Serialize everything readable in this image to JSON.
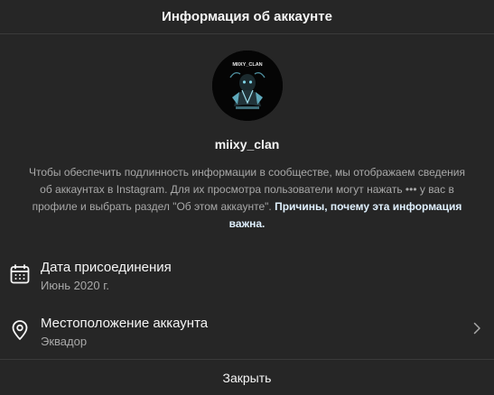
{
  "header": {
    "title": "Информация об аккаунте"
  },
  "profile": {
    "avatar_icon": "clan-logo-avatar",
    "avatar_text": "MIIXY_CLAN",
    "username": "miixy_clan",
    "description": "Чтобы обеспечить подлинность информации в сообществе, мы отображаем сведения об аккаунтах в Instagram. Для их просмотра пользователи могут нажать ••• у вас в профиле и выбрать раздел \"Об этом аккаунте\".",
    "link_text": "Причины, почему эта информация важна."
  },
  "rows": [
    {
      "icon": "calendar-icon",
      "title": "Дата присоединения",
      "value": "Июнь 2020 г."
    },
    {
      "icon": "location-pin-icon",
      "title": "Местоположение аккаунта",
      "value": "Эквадор",
      "chevron_icon": "chevron-right-icon"
    }
  ],
  "footer": {
    "close_label": "Закрыть"
  },
  "colors": {
    "background": "#262626",
    "text_primary": "#f5f5f5",
    "text_secondary": "#a8a8a8",
    "link": "#e0f1ff",
    "divider": "#3a3a3a"
  }
}
